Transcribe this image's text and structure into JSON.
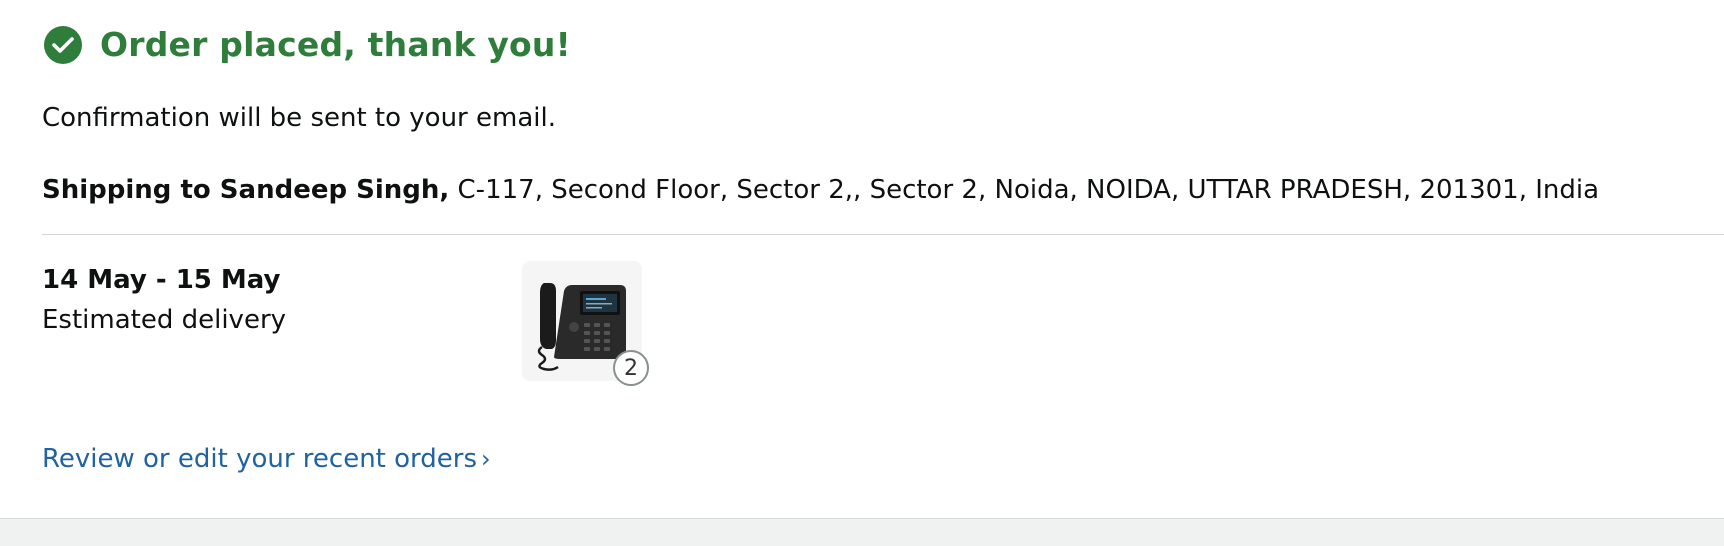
{
  "confirmation": {
    "icon": "check-circle-icon",
    "title": "Order placed, thank you!",
    "message": "Confirmation will be sent to your email.",
    "title_color": "#2e7d3a"
  },
  "shipping": {
    "label": "Shipping to Sandeep Singh,",
    "address": "C-117, Second Floor, Sector 2,, Sector 2, Noida, NOIDA, UTTAR PRADESH, 201301, India"
  },
  "delivery": {
    "date_range": "14 May - 15 May",
    "label": "Estimated delivery"
  },
  "item": {
    "image": "ip-desk-phone-image",
    "quantity": "2"
  },
  "links": {
    "review_orders": "Review or edit your recent orders",
    "chevron": "›",
    "link_color": "#2162a1"
  }
}
